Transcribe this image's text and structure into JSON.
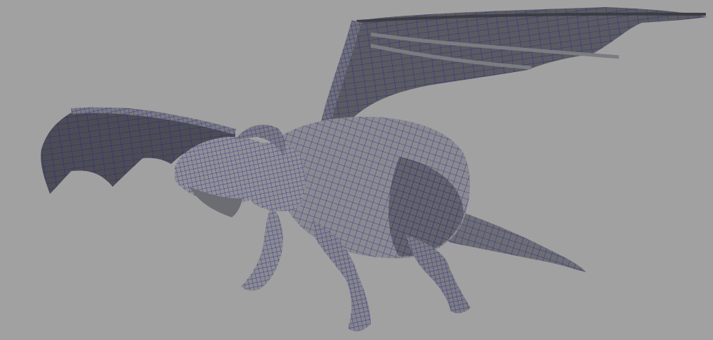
{
  "viewport": {
    "background_color": "#a1a1a1",
    "model": {
      "subject": "dragon",
      "display_mode": "shaded-with-wireframe",
      "shade_color_light": "#8a8a8f",
      "shade_color_mid": "#6b6b71",
      "shade_color_dark": "#4a4a52",
      "wire_color": "#1a1a8c"
    }
  }
}
